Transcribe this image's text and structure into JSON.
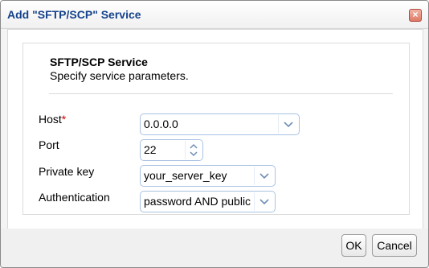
{
  "dialog": {
    "title": "Add \"SFTP/SCP\" Service",
    "close_glyph": "×"
  },
  "section": {
    "title": "SFTP/SCP Service",
    "subtitle": "Specify service parameters."
  },
  "form": {
    "host": {
      "label": "Host",
      "required_mark": "*",
      "value": "0.0.0.0"
    },
    "port": {
      "label": "Port",
      "value": "22"
    },
    "private_key": {
      "label": "Private key",
      "value": "your_server_key"
    },
    "authentication": {
      "label": "Authentication",
      "value": "password AND public"
    }
  },
  "buttons": {
    "ok": "OK",
    "cancel": "Cancel"
  },
  "icons": {
    "dropdown": "chevron-down-icon",
    "spin_up": "chevron-up-icon",
    "spin_down": "chevron-down-icon",
    "close": "close-icon"
  },
  "colors": {
    "title": "#15428b",
    "field_border": "#a9c3e3",
    "chevron": "#6f8fb8",
    "required": "#cc0000"
  }
}
